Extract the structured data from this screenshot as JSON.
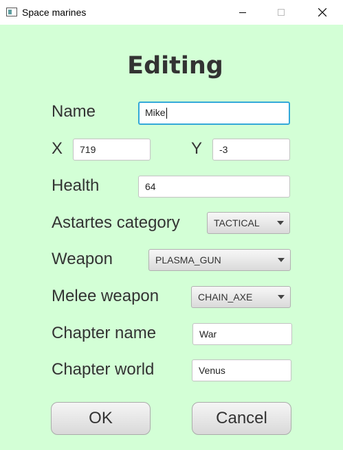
{
  "window": {
    "title": "Space marines"
  },
  "form": {
    "heading": "Editing",
    "name": {
      "label": "Name",
      "value": "Mike"
    },
    "x": {
      "label": "X",
      "value": "719"
    },
    "y": {
      "label": "Y",
      "value": "-3"
    },
    "health": {
      "label": "Health",
      "value": "64"
    },
    "astartes_category": {
      "label": "Astartes category",
      "value": "TACTICAL"
    },
    "weapon": {
      "label": "Weapon",
      "value": "PLASMA_GUN"
    },
    "melee_weapon": {
      "label": "Melee weapon",
      "value": "CHAIN_AXE"
    },
    "chapter_name": {
      "label": "Chapter name",
      "value": "War"
    },
    "chapter_world": {
      "label": "Chapter world",
      "value": "Venus"
    }
  },
  "buttons": {
    "ok": "OK",
    "cancel": "Cancel"
  },
  "colors": {
    "background": "#d3ffd6",
    "focus_border": "#32a8d8",
    "text": "#333333"
  },
  "icons": {
    "app": "app-window-icon",
    "minimize": "minimize-icon",
    "maximize": "maximize-icon",
    "close": "close-icon"
  }
}
